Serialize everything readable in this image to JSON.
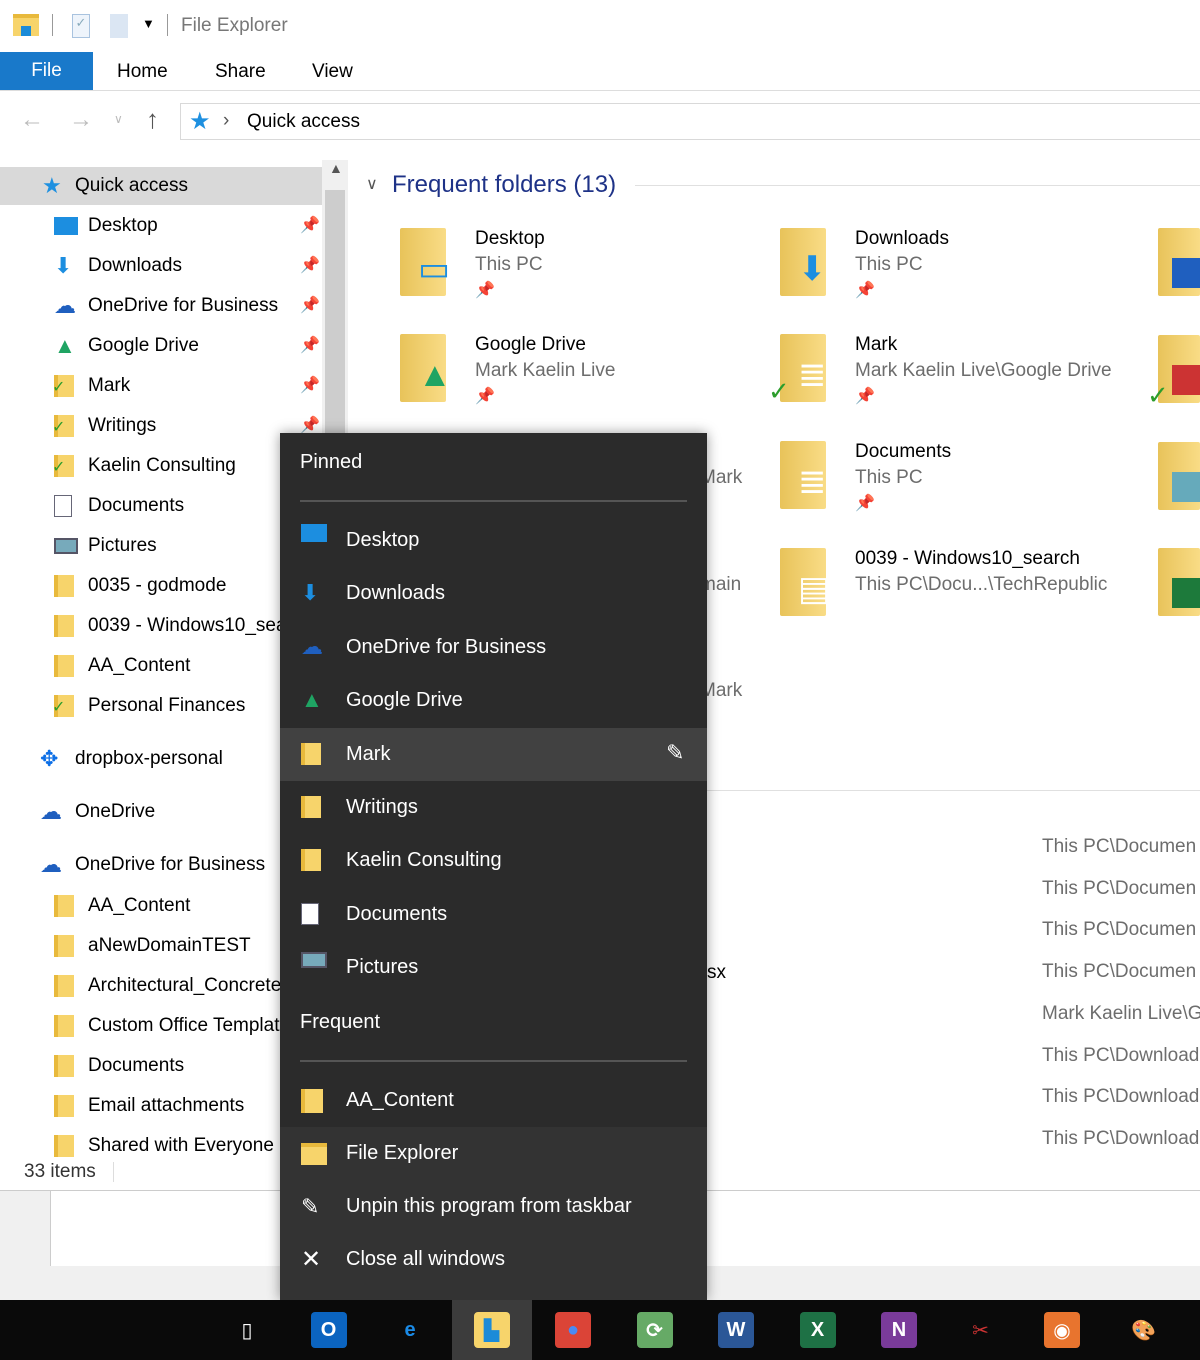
{
  "window": {
    "title": "File Explorer"
  },
  "ribbon": {
    "tabs": [
      {
        "label": "File",
        "active": true
      },
      {
        "label": "Home"
      },
      {
        "label": "Share"
      },
      {
        "label": "View"
      }
    ]
  },
  "address": {
    "path": "Quick access",
    "separator": "›"
  },
  "nav": {
    "quick_access": "Quick access",
    "items": [
      {
        "label": "Desktop",
        "icon": "desktop-icon",
        "pinned": true
      },
      {
        "label": "Downloads",
        "icon": "download-icon",
        "pinned": true
      },
      {
        "label": "OneDrive for Business",
        "icon": "onedrive-icon",
        "pinned": true
      },
      {
        "label": "Google Drive",
        "icon": "google-drive-icon",
        "pinned": true
      },
      {
        "label": "Mark",
        "icon": "folder-synced-icon",
        "pinned": true
      },
      {
        "label": "Writings",
        "icon": "folder-synced-icon",
        "pinned": true
      },
      {
        "label": "Kaelin Consulting",
        "icon": "folder-synced-icon"
      },
      {
        "label": "Documents",
        "icon": "documents-icon"
      },
      {
        "label": "Pictures",
        "icon": "pictures-icon"
      },
      {
        "label": "0035 - godmode",
        "icon": "folder-icon"
      },
      {
        "label": "0039 - Windows10_search",
        "icon": "folder-icon"
      },
      {
        "label": "AA_Content",
        "icon": "folder-icon"
      },
      {
        "label": "Personal Finances",
        "icon": "folder-synced-icon"
      }
    ],
    "dropbox": "dropbox-personal",
    "onedrive": "OneDrive",
    "onedrive_business": "OneDrive for Business",
    "business_items": [
      "AA_Content",
      "aNewDomainTEST",
      "Architectural_Concrete",
      "Custom Office Templates",
      "Documents",
      "Email attachments",
      "Shared with Everyone"
    ]
  },
  "status": {
    "items": "33 items"
  },
  "content": {
    "section_title": "Frequent folders (13)",
    "tiles": [
      {
        "name": "Desktop",
        "sub": "This PC",
        "pinned": true
      },
      {
        "name": "Downloads",
        "sub": "This PC",
        "pinned": true
      },
      {
        "name": "Google Drive",
        "sub": "Mark Kaelin Live",
        "pinned": true
      },
      {
        "name": "Mark",
        "sub": "Mark Kaelin Live\\Google Drive",
        "pinned": true
      },
      {
        "name": "Documents",
        "sub": "This PC",
        "pinned": true
      },
      {
        "name": "0039 - Windows10_search",
        "sub": "This PC\\Docu...\\TechRepublic"
      }
    ],
    "hidden_fragments": [
      "Mark",
      "main",
      "Mark",
      "sx"
    ],
    "recent_paths": [
      "This PC\\Documen",
      "This PC\\Documen",
      "This PC\\Documen",
      "This PC\\Documen",
      "Mark Kaelin Live\\G",
      "This PC\\Download",
      "This PC\\Download",
      "This PC\\Download"
    ]
  },
  "jumplist": {
    "pinned_header": "Pinned",
    "pinned": [
      "Desktop",
      "Downloads",
      "OneDrive for Business",
      "Google Drive",
      "Mark",
      "Writings",
      "Kaelin Consulting",
      "Documents",
      "Pictures"
    ],
    "hovered": "Mark",
    "frequent_header": "Frequent",
    "frequent": [
      "AA_Content"
    ],
    "actions": [
      "File Explorer",
      "Unpin this program from taskbar",
      "Close all windows"
    ]
  },
  "taskbar": {
    "apps": [
      "task-view",
      "outlook",
      "edge",
      "file-explorer",
      "chrome",
      "app-green",
      "word",
      "excel",
      "onenote",
      "snipping-tool",
      "faststone",
      "paint"
    ],
    "active": "file-explorer"
  },
  "colors": {
    "accent": "#1979ca",
    "section_title": "#1e3287",
    "jumplist_bg": "#2b2b2b",
    "taskbar_bg": "#0a0a0a"
  }
}
